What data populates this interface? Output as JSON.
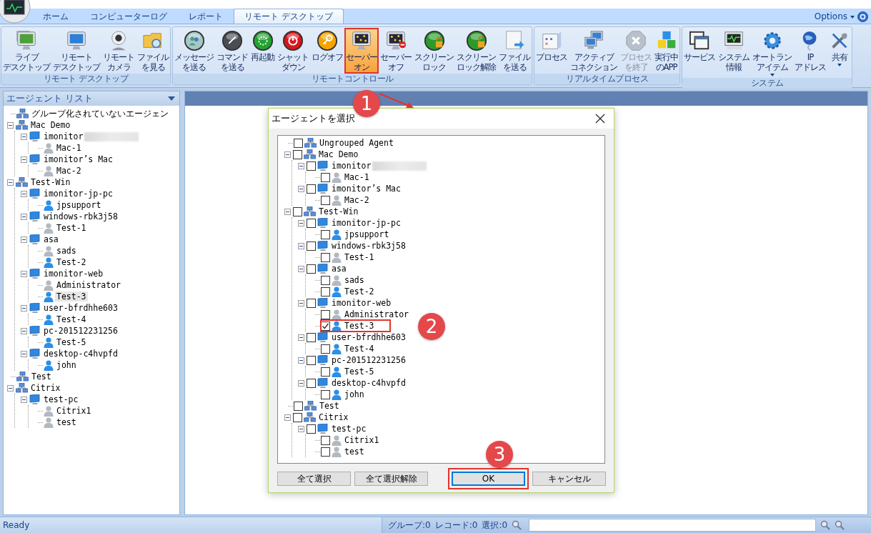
{
  "tabs": [
    {
      "label": "ホーム",
      "selected": false
    },
    {
      "label": "コンピューターログ",
      "selected": false
    },
    {
      "label": "レポート",
      "selected": false
    },
    {
      "label": "リモート デスクトップ",
      "selected": true
    }
  ],
  "options": {
    "label": "Options"
  },
  "ribbon_groups": [
    {
      "label": "リモート デスクトップ",
      "buttons": [
        {
          "lines": [
            "ライブ",
            "デスクトップ"
          ],
          "highlighted": false,
          "disabled": false,
          "dropdown": false
        },
        {
          "lines": [
            "リモート",
            "デスクトップ"
          ],
          "highlighted": false,
          "disabled": false,
          "dropdown": false
        },
        {
          "lines": [
            "リモート",
            "カメラ"
          ],
          "highlighted": false,
          "disabled": false,
          "dropdown": false
        },
        {
          "lines": [
            "ファイル",
            "を見る"
          ],
          "highlighted": false,
          "disabled": false,
          "dropdown": false
        }
      ]
    },
    {
      "label": "リモートコントロール",
      "buttons": [
        {
          "lines": [
            "メッセージ",
            "を送る"
          ],
          "highlighted": false,
          "disabled": false,
          "dropdown": false
        },
        {
          "lines": [
            "コマンド",
            "を送る"
          ],
          "highlighted": false,
          "disabled": false,
          "dropdown": false
        },
        {
          "lines": [
            "再起動"
          ],
          "highlighted": false,
          "disabled": false,
          "dropdown": false
        },
        {
          "lines": [
            "シャット",
            "ダウン"
          ],
          "highlighted": false,
          "disabled": false,
          "dropdown": false
        },
        {
          "lines": [
            "ログオフ"
          ],
          "highlighted": false,
          "disabled": false,
          "dropdown": false
        },
        {
          "lines": [
            "セーバー",
            "オン"
          ],
          "highlighted": true,
          "disabled": false,
          "dropdown": false
        },
        {
          "lines": [
            "セーバー",
            "オフ"
          ],
          "highlighted": false,
          "disabled": false,
          "dropdown": false
        },
        {
          "lines": [
            "スクリーン",
            "ロック"
          ],
          "highlighted": false,
          "disabled": false,
          "dropdown": false
        },
        {
          "lines": [
            "スクリーン",
            "ロック解除"
          ],
          "highlighted": false,
          "disabled": false,
          "dropdown": false
        },
        {
          "lines": [
            "ファイル",
            "を送る"
          ],
          "highlighted": false,
          "disabled": false,
          "dropdown": false
        }
      ]
    },
    {
      "label": "リアルタイムプロセス",
      "buttons": [
        {
          "lines": [
            "プロセス"
          ],
          "highlighted": false,
          "disabled": false,
          "dropdown": false
        },
        {
          "lines": [
            "アクティブ",
            "コネクション"
          ],
          "highlighted": false,
          "disabled": false,
          "dropdown": false
        },
        {
          "lines": [
            "プロセス",
            "を終了"
          ],
          "highlighted": false,
          "disabled": true,
          "dropdown": false
        },
        {
          "lines": [
            "実行中",
            "のAPP"
          ],
          "highlighted": false,
          "disabled": false,
          "dropdown": false
        }
      ]
    },
    {
      "label": "システム",
      "buttons": [
        {
          "lines": [
            "サービス"
          ],
          "highlighted": false,
          "disabled": false,
          "dropdown": false
        },
        {
          "lines": [
            "システム",
            "情報"
          ],
          "highlighted": false,
          "disabled": false,
          "dropdown": false
        },
        {
          "lines": [
            "オートラン",
            "アイテム"
          ],
          "highlighted": false,
          "disabled": false,
          "dropdown": true
        },
        {
          "lines": [
            "IP",
            "アドレス"
          ],
          "highlighted": false,
          "disabled": false,
          "dropdown": false
        },
        {
          "lines": [
            "共有"
          ],
          "highlighted": false,
          "disabled": false,
          "dropdown": true
        }
      ]
    }
  ],
  "left_panel": {
    "title": "エージェント リスト",
    "tree": [
      {
        "label": "グループ化されていないエージェン",
        "kind": "group",
        "selected": false
      },
      {
        "label": "Mac Demo",
        "kind": "group",
        "selected": false,
        "expanded": true,
        "children": [
          {
            "label": "imonitor",
            "kind": "computer",
            "redacted": true,
            "selected": false,
            "expanded": true,
            "children": [
              {
                "label": "Mac-1",
                "kind": "user",
                "online": false,
                "selected": false
              }
            ]
          },
          {
            "label": "imonitor’s Mac",
            "kind": "computer",
            "selected": false,
            "expanded": true,
            "children": [
              {
                "label": "Mac-2",
                "kind": "user",
                "online": false,
                "selected": false
              }
            ]
          }
        ]
      },
      {
        "label": "Test-Win",
        "kind": "group",
        "selected": false,
        "expanded": true,
        "children": [
          {
            "label": "imonitor-jp-pc",
            "kind": "computer",
            "selected": false,
            "expanded": true,
            "children": [
              {
                "label": "jpsupport",
                "kind": "user",
                "online": true,
                "selected": false
              }
            ]
          },
          {
            "label": "windows-rbk3j58",
            "kind": "computer",
            "selected": false,
            "expanded": true,
            "children": [
              {
                "label": "Test-1",
                "kind": "user",
                "online": false,
                "selected": false
              }
            ]
          },
          {
            "label": "asa",
            "kind": "computer",
            "selected": false,
            "expanded": true,
            "children": [
              {
                "label": "sads",
                "kind": "user",
                "online": false,
                "selected": false
              },
              {
                "label": "Test-2",
                "kind": "user",
                "online": true,
                "selected": false
              }
            ]
          },
          {
            "label": "imonitor-web",
            "kind": "computer",
            "selected": false,
            "expanded": true,
            "children": [
              {
                "label": "Administrator",
                "kind": "user",
                "online": false,
                "selected": false
              },
              {
                "label": "Test-3",
                "kind": "user",
                "online": true,
                "selected": true
              }
            ]
          },
          {
            "label": "user-bfrdhhe603",
            "kind": "computer",
            "selected": false,
            "expanded": true,
            "children": [
              {
                "label": "Test-4",
                "kind": "user",
                "online": true,
                "selected": false
              }
            ]
          },
          {
            "label": "pc-201512231256",
            "kind": "computer",
            "selected": false,
            "expanded": true,
            "children": [
              {
                "label": "Test-5",
                "kind": "user",
                "online": true,
                "selected": false
              }
            ]
          },
          {
            "label": "desktop-c4hvpfd",
            "kind": "computer",
            "selected": false,
            "expanded": true,
            "children": [
              {
                "label": "john",
                "kind": "user",
                "online": true,
                "selected": false
              }
            ]
          }
        ]
      },
      {
        "label": "Test",
        "kind": "group",
        "selected": false
      },
      {
        "label": "Citrix",
        "kind": "group",
        "selected": false,
        "expanded": true,
        "children": [
          {
            "label": "test-pc",
            "kind": "computer",
            "selected": false,
            "expanded": true,
            "children": [
              {
                "label": "Citrix1",
                "kind": "user",
                "online": false,
                "selected": false
              },
              {
                "label": "test",
                "kind": "user",
                "online": false,
                "selected": false
              }
            ]
          }
        ]
      }
    ]
  },
  "dialog": {
    "title": "エージェントを選択",
    "tree": [
      {
        "label": "Ungrouped Agent",
        "kind": "group",
        "checked": false
      },
      {
        "label": "Mac Demo",
        "kind": "group",
        "checked": false,
        "expanded": true,
        "children": [
          {
            "label": "imonitor",
            "kind": "computer",
            "redacted": true,
            "checked": false,
            "expanded": true,
            "children": [
              {
                "label": "Mac-1",
                "kind": "user",
                "online": false,
                "checked": false
              }
            ]
          },
          {
            "label": "imonitor’s Mac",
            "kind": "computer",
            "checked": false,
            "expanded": true,
            "children": [
              {
                "label": "Mac-2",
                "kind": "user",
                "online": false,
                "checked": false
              }
            ]
          }
        ]
      },
      {
        "label": "Test-Win",
        "kind": "group",
        "checked": false,
        "expanded": true,
        "children": [
          {
            "label": "imonitor-jp-pc",
            "kind": "computer",
            "checked": false,
            "expanded": true,
            "children": [
              {
                "label": "jpsupport",
                "kind": "user",
                "online": true,
                "checked": false
              }
            ]
          },
          {
            "label": "windows-rbk3j58",
            "kind": "computer",
            "checked": false,
            "expanded": true,
            "children": [
              {
                "label": "Test-1",
                "kind": "user",
                "online": false,
                "checked": false
              }
            ]
          },
          {
            "label": "asa",
            "kind": "computer",
            "checked": false,
            "expanded": true,
            "children": [
              {
                "label": "sads",
                "kind": "user",
                "online": false,
                "checked": false
              },
              {
                "label": "Test-2",
                "kind": "user",
                "online": true,
                "checked": false
              }
            ]
          },
          {
            "label": "imonitor-web",
            "kind": "computer",
            "checked": false,
            "expanded": true,
            "children": [
              {
                "label": "Administrator",
                "kind": "user",
                "online": false,
                "checked": false
              },
              {
                "label": "Test-3",
                "kind": "user",
                "online": true,
                "checked": true,
                "highlighted": true
              }
            ]
          },
          {
            "label": "user-bfrdhhe603",
            "kind": "computer",
            "checked": false,
            "expanded": true,
            "children": [
              {
                "label": "Test-4",
                "kind": "user",
                "online": true,
                "checked": false
              }
            ]
          },
          {
            "label": "pc-201512231256",
            "kind": "computer",
            "checked": false,
            "expanded": true,
            "children": [
              {
                "label": "Test-5",
                "kind": "user",
                "online": true,
                "checked": false
              }
            ]
          },
          {
            "label": "desktop-c4hvpfd",
            "kind": "computer",
            "checked": false,
            "expanded": true,
            "children": [
              {
                "label": "john",
                "kind": "user",
                "online": true,
                "checked": false
              }
            ]
          }
        ]
      },
      {
        "label": "Test",
        "kind": "group",
        "checked": false
      },
      {
        "label": "Citrix",
        "kind": "group",
        "checked": false,
        "expanded": true,
        "children": [
          {
            "label": "test-pc",
            "kind": "computer",
            "checked": false,
            "expanded": true,
            "children": [
              {
                "label": "Citrix1",
                "kind": "user",
                "online": false,
                "checked": false
              },
              {
                "label": "test",
                "kind": "user",
                "online": false,
                "checked": false
              }
            ]
          }
        ]
      }
    ],
    "buttons": [
      {
        "label": "全て選択",
        "highlighted": false,
        "focused": false
      },
      {
        "label": "全て選択解除",
        "highlighted": false,
        "focused": false
      },
      {
        "label": "OK",
        "highlighted": true,
        "focused": true
      },
      {
        "label": "キャンセル",
        "highlighted": false,
        "focused": false
      }
    ]
  },
  "callouts": [
    "1",
    "2",
    "3"
  ],
  "status_bar": {
    "status": "Ready",
    "counters": [
      "グループ:0",
      "レコード:0",
      "選択:0"
    ]
  }
}
